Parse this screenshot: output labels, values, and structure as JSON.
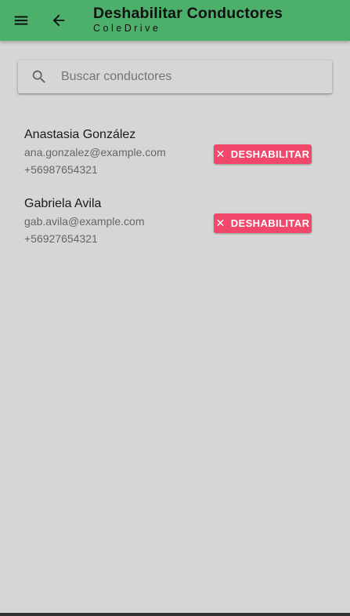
{
  "header": {
    "title": "Deshabilitar Conductores",
    "subtitle": "ColeDrive",
    "menu_icon": "menu-icon",
    "back_icon": "arrow-back-icon"
  },
  "search": {
    "placeholder": "Buscar conductores",
    "value": "",
    "icon": "search-icon"
  },
  "drivers": [
    {
      "name": "Anastasia González",
      "email": "ana.gonzalez@example.com",
      "phone": "+56987654321",
      "action_label": "DESHABILITAR",
      "action_icon_glyph": "✕"
    },
    {
      "name": "Gabriela Avila",
      "email": "gab.avila@example.com",
      "phone": "+56927654321",
      "action_label": "DESHABILITAR",
      "action_icon_glyph": "✕"
    }
  ],
  "colors": {
    "appbar": "#4caf6a",
    "background": "#d6d6d6",
    "danger": "#f0476a"
  }
}
